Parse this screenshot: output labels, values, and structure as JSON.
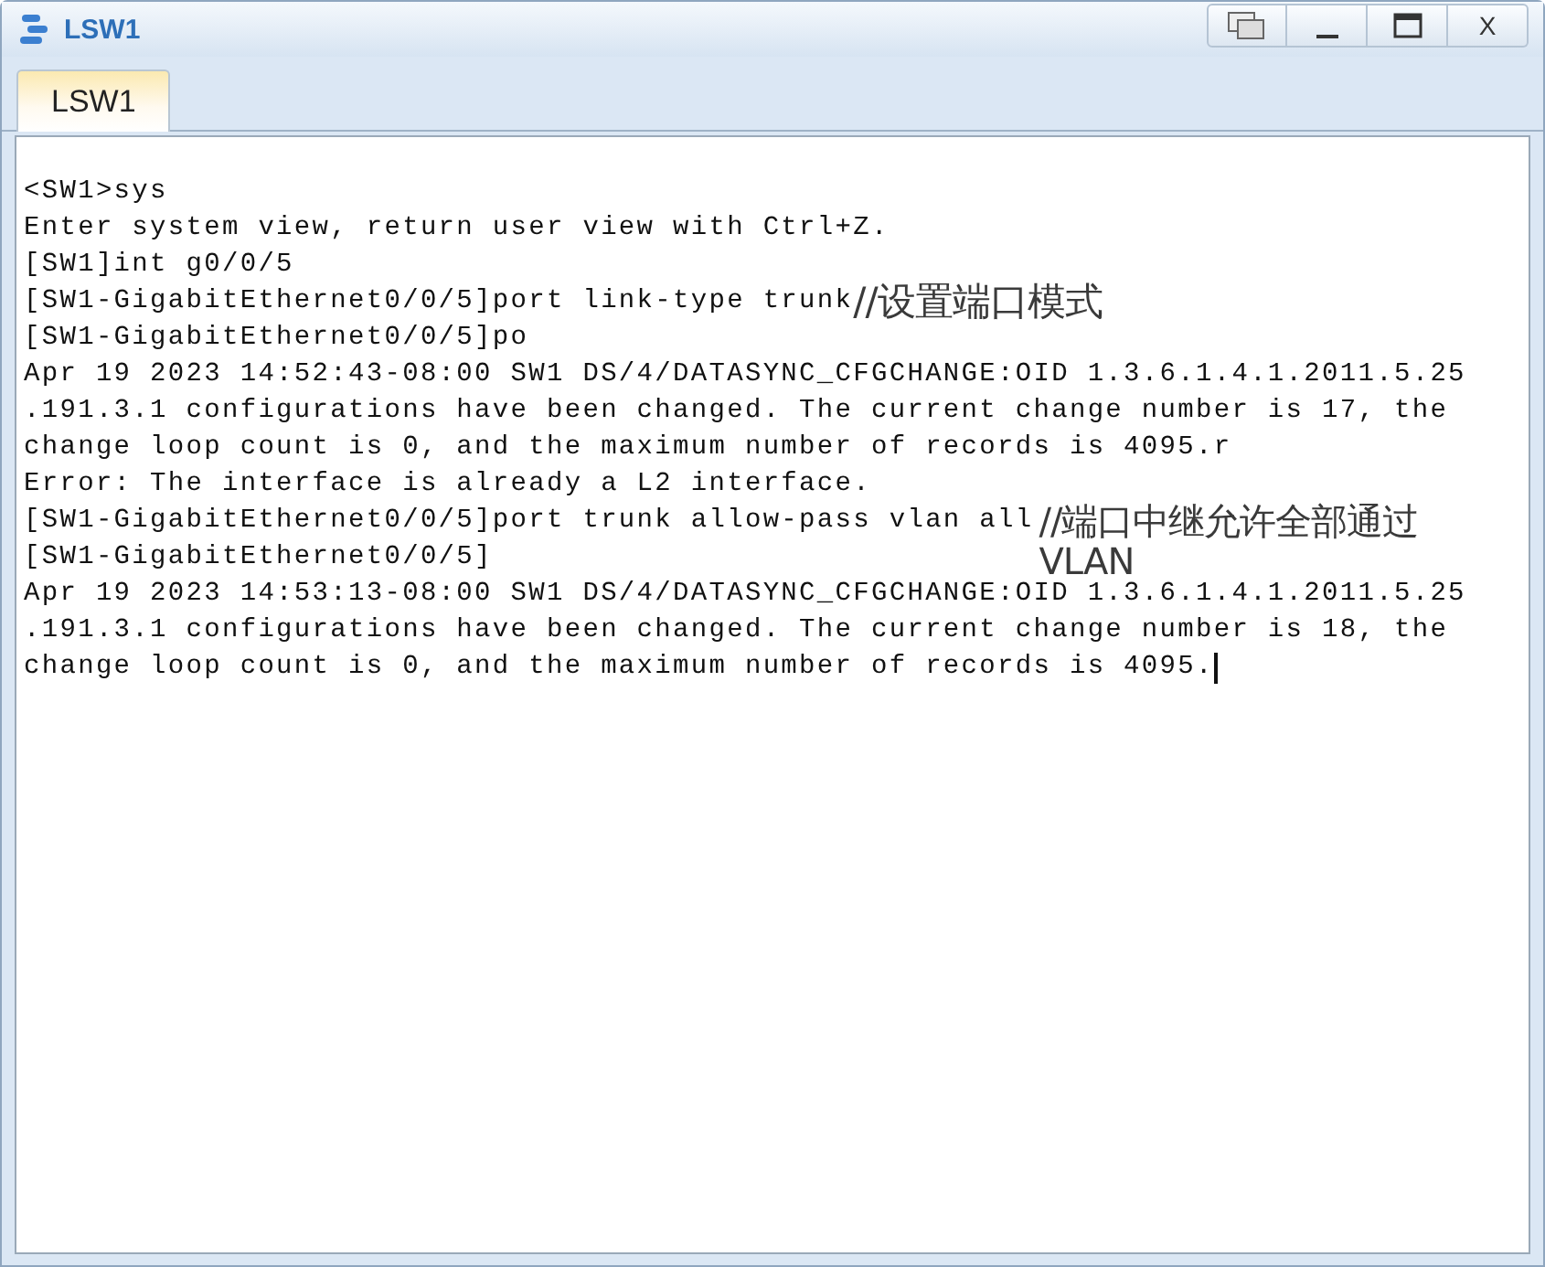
{
  "window": {
    "title": "LSW1",
    "close_label": "X"
  },
  "tabs": [
    {
      "label": "LSW1",
      "selected": true
    }
  ],
  "terminal": {
    "cursor_visible": true,
    "lines": [
      {
        "text": "<SW1>sys"
      },
      {
        "text": "Enter system view, return user view with Ctrl+Z."
      },
      {
        "text": "[SW1]int g0/0/5"
      },
      {
        "text": "[SW1-GigabitEthernet0/0/5]port link-type trunk",
        "annotation": {
          "kind": "inline",
          "text": "//设置端口模式"
        }
      },
      {
        "text": "[SW1-GigabitEthernet0/0/5]po"
      },
      {
        "text": "Apr 19 2023 14:52:43-08:00 SW1 DS/4/DATASYNC_CFGCHANGE:OID 1.3.6.1.4.1.2011.5.25"
      },
      {
        "text": ".191.3.1 configurations have been changed. The current change number is 17, the"
      },
      {
        "text": "change loop count is 0, and the maximum number of records is 4095.r"
      },
      {
        "text": "Error: The interface is already a L2 interface."
      },
      {
        "text": "[SW1-GigabitEthernet0/0/5]port trunk allow-pass vlan all",
        "annotation": {
          "kind": "overlay",
          "text": "//端口中继允许全部通过VLAN"
        }
      },
      {
        "text": "[SW1-GigabitEthernet0/0/5]"
      },
      {
        "text": "Apr 19 2023 14:53:13-08:00 SW1 DS/4/DATASYNC_CFGCHANGE:OID 1.3.6.1.4.1.2011.5.25"
      },
      {
        "text": ".191.3.1 configurations have been changed. The current change number is 18, the"
      },
      {
        "text": "change loop count is 0, and the maximum number of records is 4095."
      }
    ]
  }
}
